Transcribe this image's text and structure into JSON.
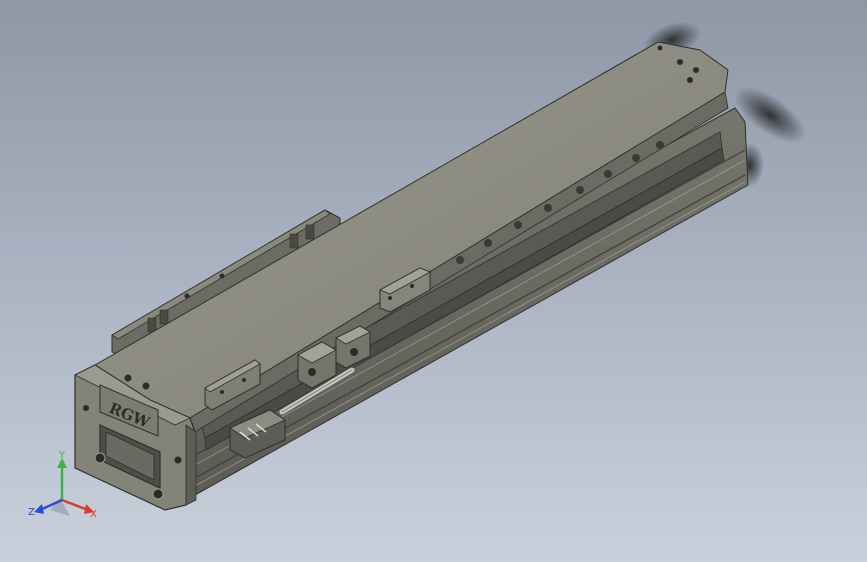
{
  "model": {
    "brand_text": "RGW"
  },
  "triad": {
    "y_label": "Y",
    "z_label": "Z",
    "x_label": "X"
  },
  "colors": {
    "background_top": "#8e97a5",
    "background_bottom": "#c9d1dc",
    "body_top": "#8d8c80",
    "body_side": "#6f6e66",
    "body_front": "#7c7b72",
    "axis_x": "#d93a2b",
    "axis_y": "#3bb34a",
    "axis_z": "#2a4bd6"
  }
}
